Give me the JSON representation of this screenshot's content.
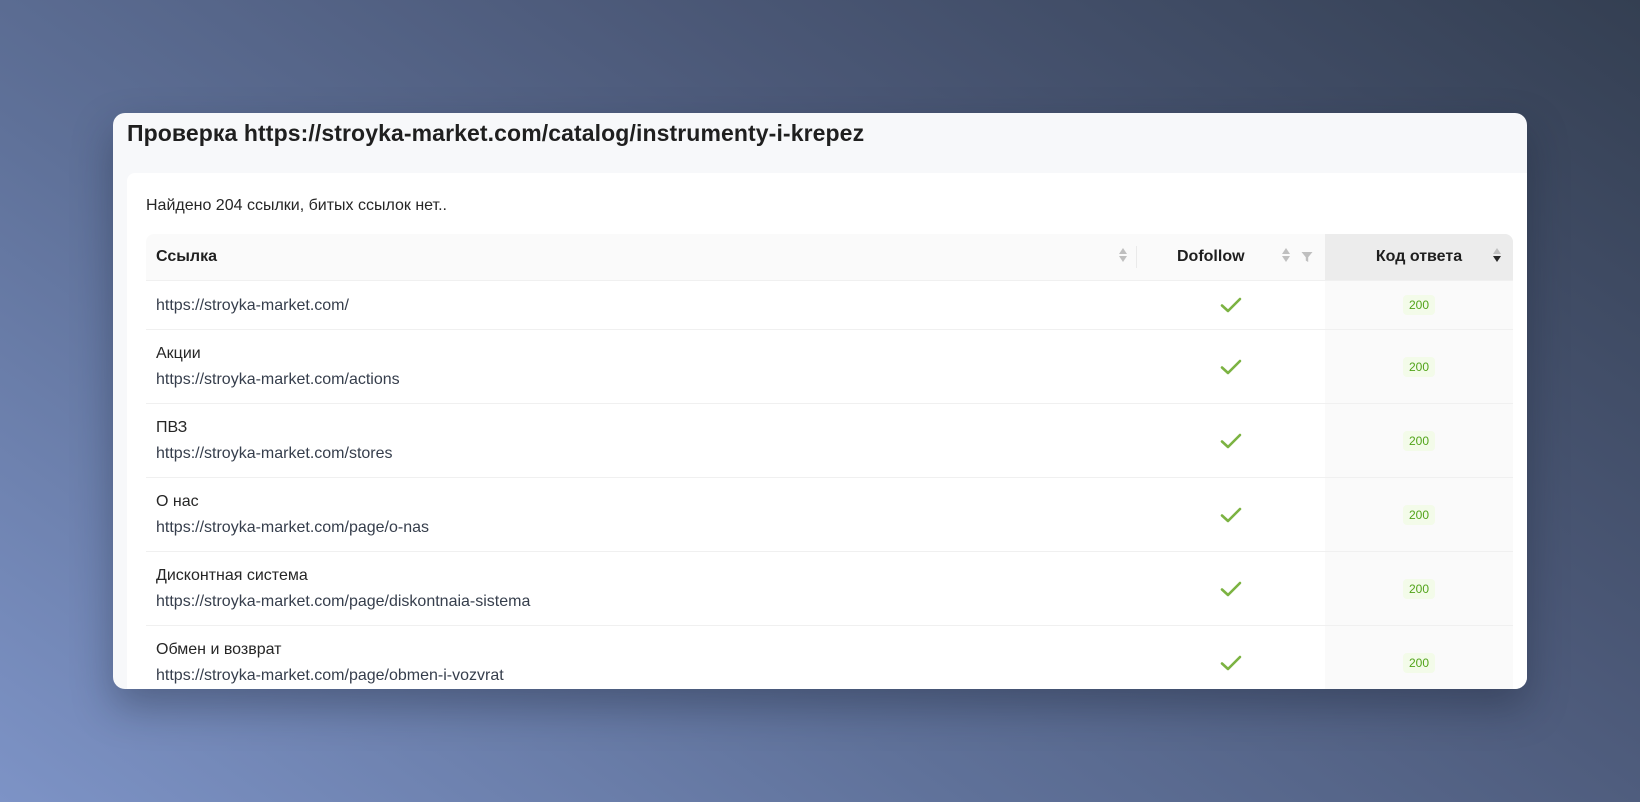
{
  "page": {
    "title": "Проверка https://stroyka-market.com/catalog/instrumenty-i-krepez",
    "summary": "Найдено 204 ссылки, битых ссылок нет.."
  },
  "table": {
    "columns": {
      "link": "Ссылка",
      "dofollow": "Dofollow",
      "code": "Код ответа"
    },
    "rows": [
      {
        "name": "",
        "url": "https://stroyka-market.com/",
        "dofollow": true,
        "code": "200"
      },
      {
        "name": "Акции",
        "url": "https://stroyka-market.com/actions",
        "dofollow": true,
        "code": "200"
      },
      {
        "name": "ПВЗ",
        "url": "https://stroyka-market.com/stores",
        "dofollow": true,
        "code": "200"
      },
      {
        "name": "О нас",
        "url": "https://stroyka-market.com/page/o-nas",
        "dofollow": true,
        "code": "200"
      },
      {
        "name": "Дисконтная система",
        "url": "https://stroyka-market.com/page/diskontnaia-sistema",
        "dofollow": true,
        "code": "200"
      },
      {
        "name": "Обмен и возврат",
        "url": "https://stroyka-market.com/page/obmen-i-vozvrat",
        "dofollow": true,
        "code": "200"
      }
    ]
  },
  "colors": {
    "check": "#7cb342",
    "badge_text": "#52a41a",
    "badge_bg": "#f3fbe9"
  },
  "icons": {
    "sort": "sort-icon",
    "filter": "filter-icon",
    "check": "check-icon"
  }
}
